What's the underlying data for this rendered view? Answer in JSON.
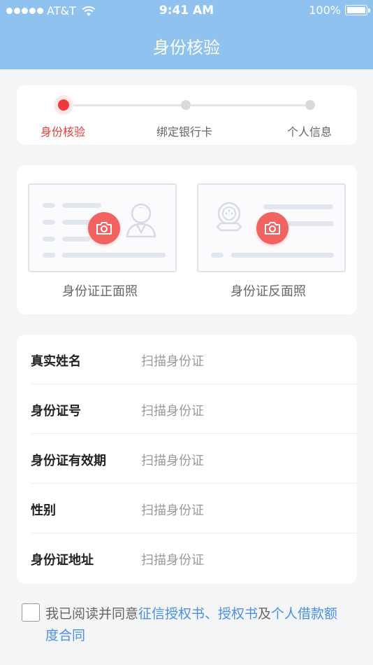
{
  "status_bar": {
    "carrier": "AT&T",
    "time": "9:41 AM",
    "battery": "100%"
  },
  "nav": {
    "title": "身份核验"
  },
  "steps": [
    {
      "label": "身份核验",
      "active": true
    },
    {
      "label": "绑定银行卡",
      "active": false
    },
    {
      "label": "个人信息",
      "active": false
    }
  ],
  "photos": {
    "front_label": "身份证正面照",
    "back_label": "身份证反面照"
  },
  "form": [
    {
      "label": "真实姓名",
      "placeholder": "扫描身份证"
    },
    {
      "label": "身份证号",
      "placeholder": "扫描身份证"
    },
    {
      "label": "身份证有效期",
      "placeholder": "扫描身份证"
    },
    {
      "label": "性别",
      "placeholder": "扫描身份证"
    },
    {
      "label": "身份证地址",
      "placeholder": "扫描身份证"
    }
  ],
  "agreement": {
    "prefix": "我已阅读并同意",
    "link1": "征信授权书、授权书",
    "conj": "及",
    "link2": "个人借款额度合同"
  },
  "colors": {
    "header": "#90c2f0",
    "accent": "#f0393b",
    "link": "#4a90e2",
    "camera": "#f06360"
  }
}
